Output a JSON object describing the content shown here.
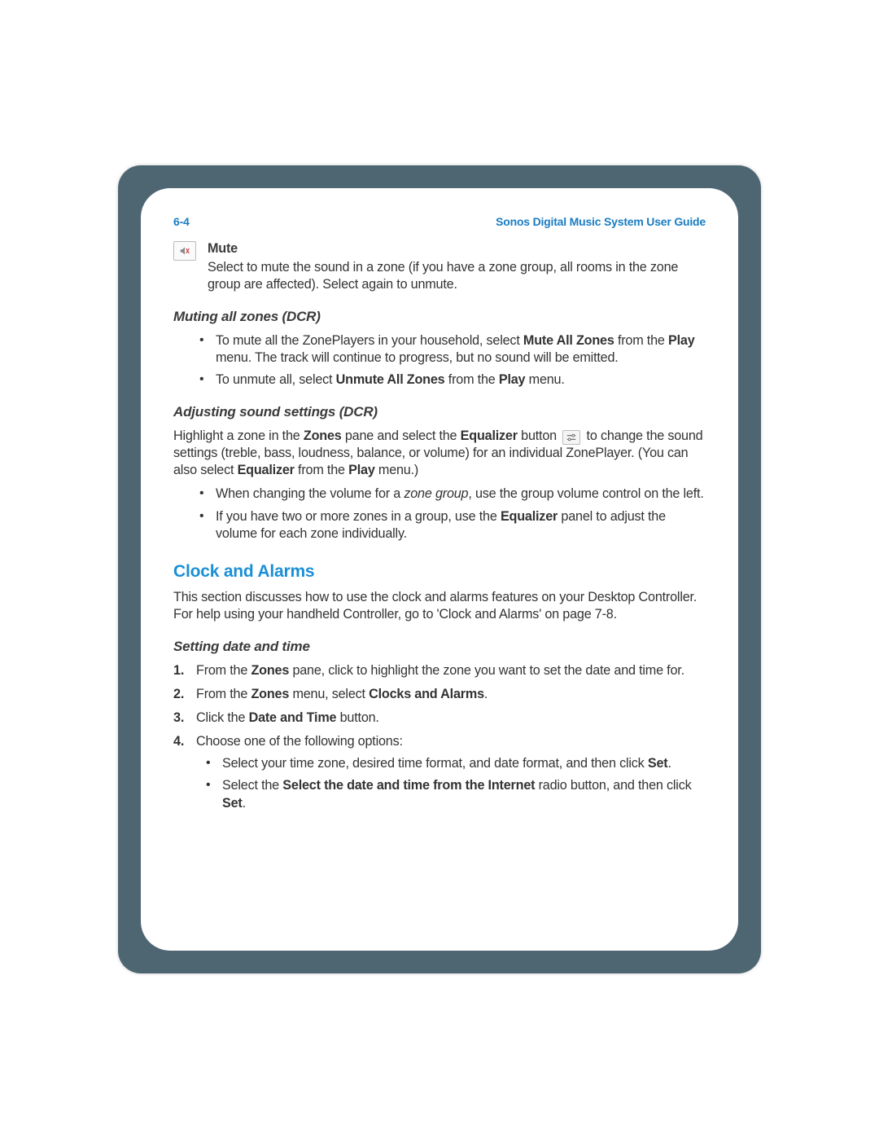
{
  "header": {
    "page_num": "6-4",
    "guide_title": "Sonos Digital Music System User Guide"
  },
  "mute": {
    "label": "Mute",
    "desc_p1": "Select to mute the sound in a zone (if you have a zone group, all rooms in the zone group are affected). Select again to unmute."
  },
  "muting_all": {
    "heading": "Muting all zones (DCR)",
    "b1_pre": "To mute all the ZonePlayers in your household, select ",
    "b1_bold1": "Mute All Zones",
    "b1_mid": " from the ",
    "b1_bold2": "Play",
    "b1_post": " menu. The track will continue to progress, but no sound will be emitted.",
    "b2_pre": "To unmute all, select ",
    "b2_bold1": "Unmute All Zones",
    "b2_mid": " from the ",
    "b2_bold2": "Play",
    "b2_post": " menu."
  },
  "adjusting": {
    "heading": "Adjusting sound settings (DCR)",
    "p1_pre": "Highlight a zone in the ",
    "p1_zones": "Zones",
    "p1_mid1": " pane and select the ",
    "p1_eq": "Equalizer",
    "p1_mid2": " button ",
    "p1_post": " to change the sound settings (treble, bass, loudness, balance, or volume) for an individual ZonePlayer. (You can also select ",
    "p1_eq2": "Equalizer",
    "p1_mid3": " from the ",
    "p1_play": "Play",
    "p1_end": " menu.)",
    "b1_pre": "When changing the volume for a ",
    "b1_it": "zone group",
    "b1_post": ", use the group volume control on the left.",
    "b2_pre": "If you have two or more zones in a group, use the ",
    "b2_bold": "Equalizer",
    "b2_post": " panel to adjust the volume for each zone individually."
  },
  "clock": {
    "title": "Clock and Alarms",
    "intro": "This section discusses how to use the clock and alarms features on your Desktop Controller. For help using your handheld Controller, go to 'Clock and Alarms' on page 7-8.",
    "subheading": "Setting date and time",
    "s1_pre": "From the ",
    "s1_zones": "Zones",
    "s1_post": " pane, click to highlight the zone you want to set the date and time for.",
    "s2_pre": "From the ",
    "s2_zones": "Zones",
    "s2_mid": " menu, select ",
    "s2_bold": "Clocks and Alarms",
    "s2_end": ".",
    "s3_pre": "Click the ",
    "s3_bold": "Date and Time",
    "s3_post": " button.",
    "s4": "Choose one of the following options:",
    "s4b1_pre": "Select your time zone, desired time format, and date format, and then click ",
    "s4b1_bold": "Set",
    "s4b1_end": ".",
    "s4b2_pre": "Select the ",
    "s4b2_bold": "Select the date and time from the Internet",
    "s4b2_mid": " radio button, and then click ",
    "s4b2_bold2": "Set",
    "s4b2_end": "."
  }
}
